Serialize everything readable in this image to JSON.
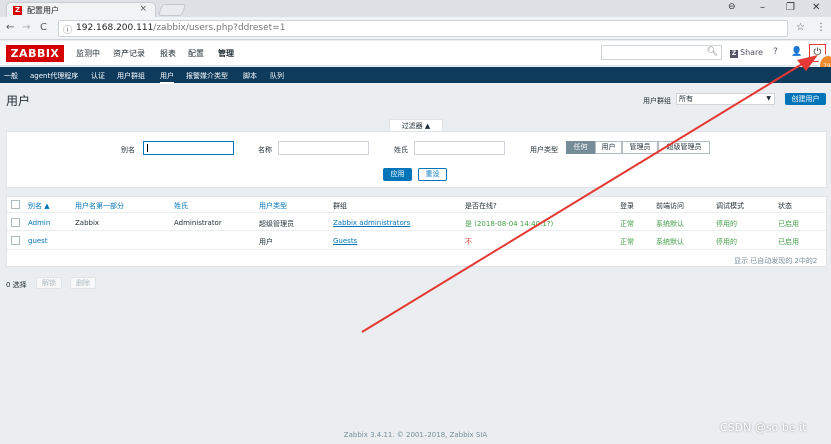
{
  "browser": {
    "tab_title": "配置用户",
    "tab_close": "×",
    "url_host": "192.168.200.111",
    "url_path": "/zabbix/users.php?ddreset=1",
    "win_min": "–",
    "win_max": "❐",
    "win_close": "✕",
    "back": "←",
    "forward": "→",
    "reload": "C",
    "info": "ⓘ",
    "star": "☆",
    "menu": "⋮"
  },
  "header": {
    "logo": "ZABBIX",
    "menu": [
      "监测中",
      "资产记录",
      "报表",
      "配置",
      "管理"
    ],
    "share": "Share",
    "share_icon": "Z",
    "help": "?",
    "profile": "👤",
    "logout": "⏻",
    "badge": "79"
  },
  "submenu": [
    "一般",
    "agent代理程序",
    "认证",
    "用户群组",
    "用户",
    "报警媒介类型",
    "脚本",
    "队列"
  ],
  "page": {
    "title": "用户",
    "group_label": "用户群组",
    "group_value": "所有",
    "create_button": "创建用户"
  },
  "filter": {
    "tab": "过滤器 ▲",
    "alias_label": "别名",
    "name_label": "名称",
    "surname_label": "姓氏",
    "type_label": "用户类型",
    "type_options": [
      "任何",
      "用户",
      "管理员",
      "超级管理员"
    ],
    "apply": "应用",
    "reset": "重设"
  },
  "table": {
    "headers": [
      "别名 ▲",
      "用户名第一部分",
      "姓氏",
      "用户类型",
      "群组",
      "是否在线?",
      "登录",
      "前端访问",
      "调试模式",
      "状态"
    ],
    "rows": [
      {
        "alias": "Admin",
        "name": "Zabbix",
        "surname": "Administrator",
        "type": "超级管理员",
        "groups": "Zabbix administrators",
        "online": "是 (2018-08-04 14:40:1?)",
        "login": "正常",
        "frontend": "系统默认",
        "debug": "停用的",
        "status": "已启用"
      },
      {
        "alias": "guest",
        "name": "",
        "surname": "",
        "type": "用户",
        "groups": "Guests",
        "online": "不",
        "login": "正常",
        "frontend": "系统默认",
        "debug": "停用的",
        "status": "已启用"
      }
    ],
    "footer": "显示 已自动发现的 2中的2"
  },
  "bulk": {
    "selected": "0 选择",
    "unblock": "解锁",
    "delete": "删除"
  },
  "footer": {
    "copyright": "Zabbix 3.4.11. © 2001–2018, Zabbix SIA",
    "watermark": "CSDN @so be it"
  },
  "colors": {
    "brand": "#d40000",
    "accent": "#0275b8",
    "nav": "#0e3a5c",
    "arrow": "#e53935",
    "ok": "#429e47"
  }
}
